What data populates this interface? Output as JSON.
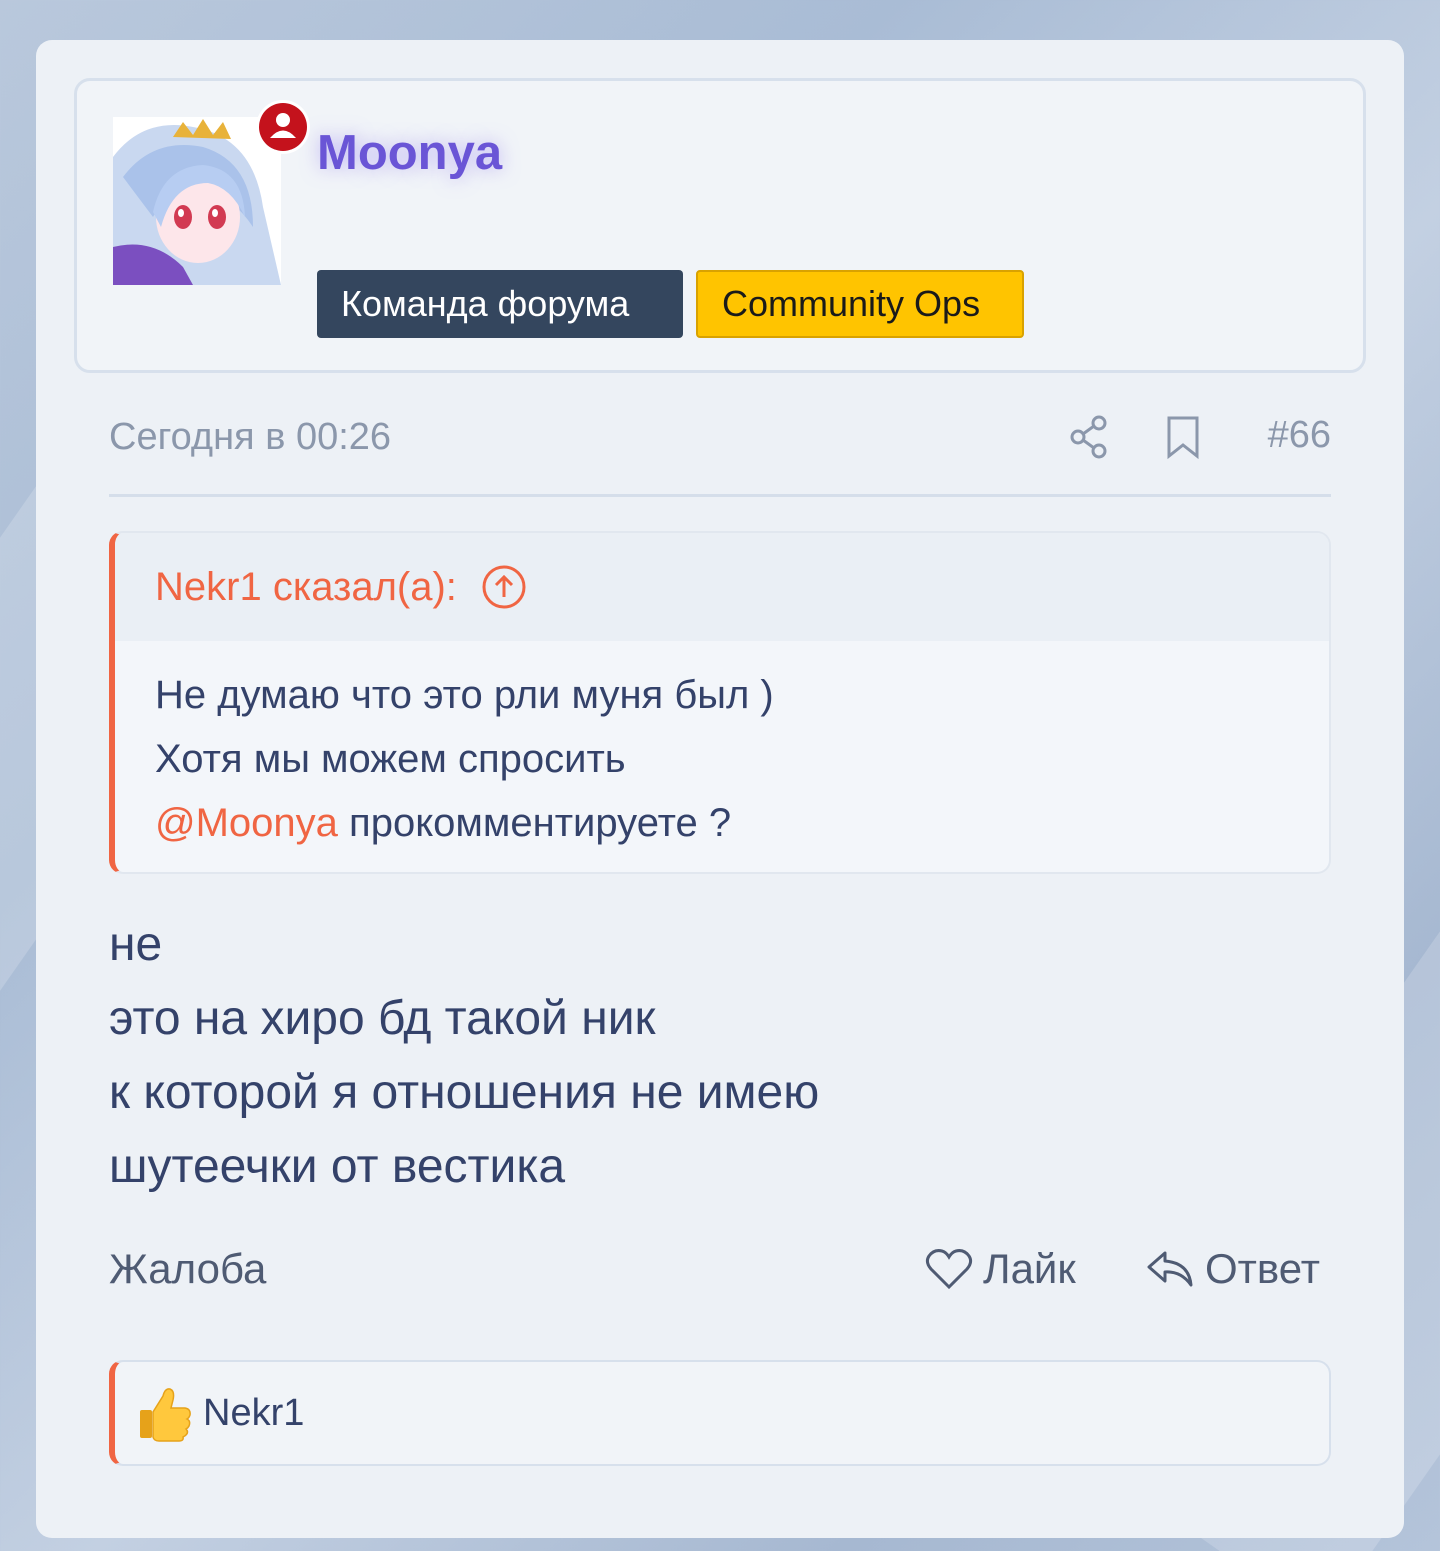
{
  "author": {
    "username": "Moonya",
    "badges": [
      "Команда форума",
      "Community Ops"
    ],
    "online_icon": "user-online-icon"
  },
  "post": {
    "time": "Сегодня в 00:26",
    "number": "#66",
    "quote": {
      "header": "Nekr1 сказал(а):",
      "line1": "Не думаю что это рли муня был )",
      "line2": "Хотя мы можем спросить",
      "mention": "@Moonya",
      "line3_rest": " прокомментируете ?"
    },
    "message": [
      "не",
      "это на хиро бд такой ник",
      "к которой я отношения не имею",
      "шутеечки от вестика"
    ]
  },
  "actions": {
    "report": "Жалоба",
    "like": "Лайк",
    "reply": "Ответ"
  },
  "reactions": {
    "icon": "thumbs-up-icon",
    "users": "Nekr1"
  },
  "colors": {
    "accent": "#f06543",
    "username": "#6a55d6",
    "badge_team": "#34465e",
    "badge_ops": "#ffc400",
    "text": "#34426a"
  }
}
